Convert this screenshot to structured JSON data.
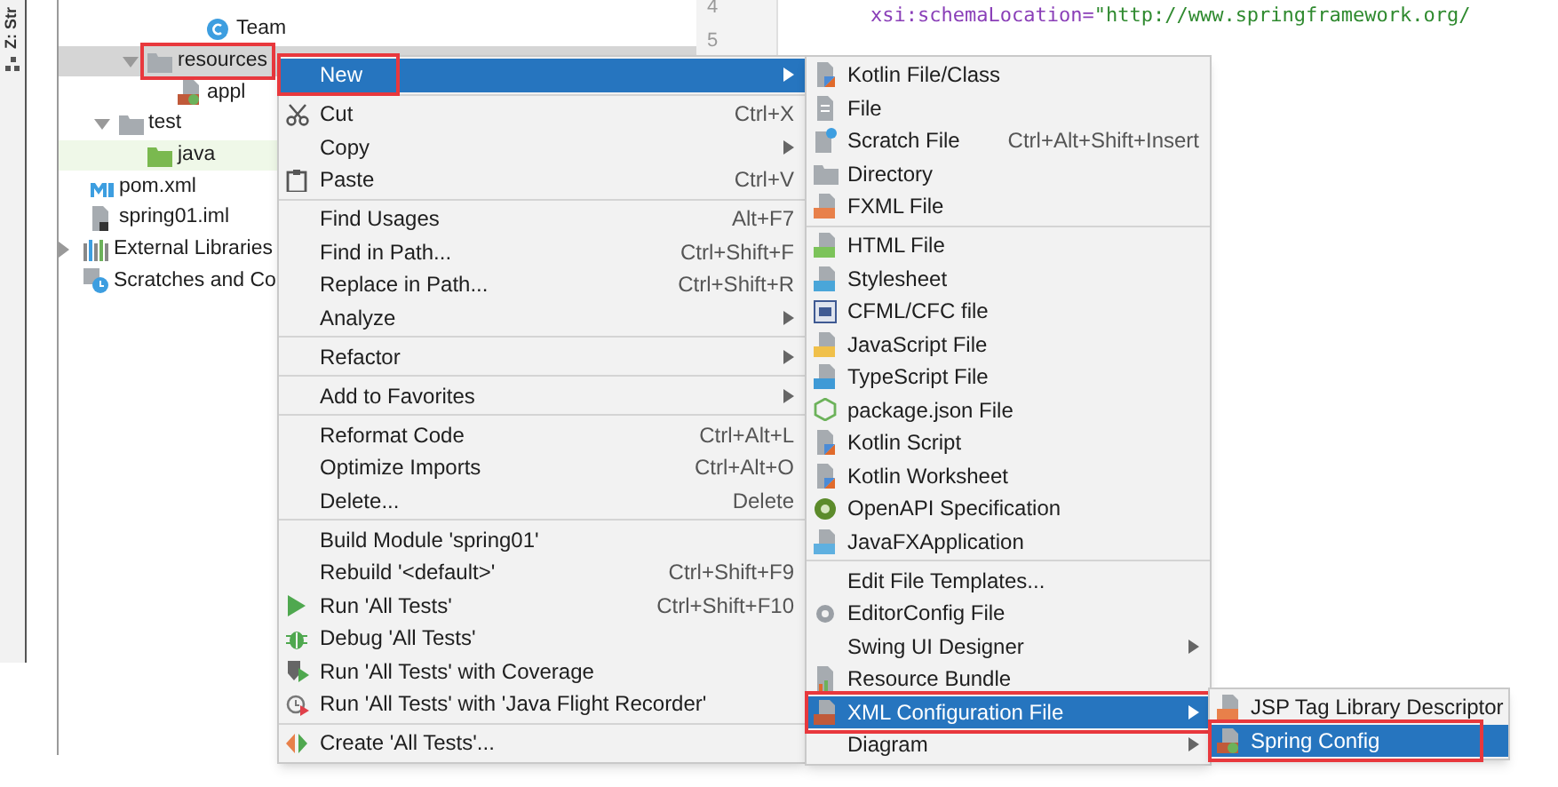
{
  "side_strip": {
    "label": "Z: Str"
  },
  "project_tree": [
    {
      "children": [
        {
          "children": [
            {
              "children": [
                {
                  "children": [
                    {
                      "children": [
                        {
                          "label": "Team",
                          "kind": "class"
                        }
                      ]
                    }
                  ]
                },
                {
                  "label": "resources",
                  "kind": "folder",
                  "expanded": true,
                  "selected": true,
                  "annotated": true,
                  "children": [
                    {
                      "label": "appl",
                      "kind": "xml"
                    }
                  ]
                }
              ]
            },
            {
              "label": "test",
              "kind": "folder",
              "expanded": true,
              "children": [
                {
                  "label": "java",
                  "kind": "test-root"
                }
              ]
            }
          ]
        },
        {
          "label": "pom.xml",
          "kind": "maven"
        },
        {
          "label": "spring01.iml",
          "kind": "module-file"
        }
      ]
    },
    {
      "label": "External Libraries",
      "kind": "libraries",
      "expanded": false
    },
    {
      "label": "Scratches and Co",
      "kind": "scratches"
    }
  ],
  "gutter": {
    "line_numbers": [
      "4",
      "5"
    ]
  },
  "editor": {
    "attribute": "xsi:schemaLocation=",
    "value": "\"http://www.springframework.org/"
  },
  "context_menu": {
    "groups": [
      [
        {
          "label": "New",
          "submenu": true,
          "selected": true,
          "annotated": true
        }
      ],
      [
        {
          "label": "Cut",
          "shortcut": "Ctrl+X",
          "selected": false
        },
        {
          "label": "Copy",
          "submenu": true,
          "selected": false
        },
        {
          "label": "Paste",
          "shortcut": "Ctrl+V",
          "selected": false
        }
      ],
      [
        {
          "label": "Find Usages",
          "shortcut": "Alt+F7",
          "selected": false
        },
        {
          "label": "Find in Path...",
          "shortcut": "Ctrl+Shift+F",
          "selected": false
        },
        {
          "label": "Replace in Path...",
          "shortcut": "Ctrl+Shift+R",
          "selected": false
        },
        {
          "label": "Analyze",
          "submenu": true,
          "selected": false
        }
      ],
      [
        {
          "label": "Refactor",
          "submenu": true,
          "selected": false
        }
      ],
      [
        {
          "label": "Add to Favorites",
          "submenu": true,
          "selected": false
        }
      ],
      [
        {
          "label": "Reformat Code",
          "shortcut": "Ctrl+Alt+L",
          "selected": false
        },
        {
          "label": "Optimize Imports",
          "shortcut": "Ctrl+Alt+O",
          "selected": false
        },
        {
          "label": "Delete...",
          "shortcut": "Delete",
          "selected": false
        }
      ],
      [
        {
          "label": "Build Module 'spring01'",
          "selected": false
        },
        {
          "label": "Rebuild '<default>'",
          "shortcut": "Ctrl+Shift+F9",
          "selected": false
        },
        {
          "label": "Run 'All Tests'",
          "shortcut": "Ctrl+Shift+F10",
          "selected": false
        },
        {
          "label": "Debug 'All Tests'",
          "selected": false
        },
        {
          "label": "Run 'All Tests' with Coverage",
          "selected": false
        },
        {
          "label": "Run 'All Tests' with 'Java Flight Recorder'",
          "selected": false
        }
      ],
      [
        {
          "label": "Create 'All Tests'...",
          "selected": false
        }
      ]
    ]
  },
  "new_submenu": {
    "groups": [
      [
        {
          "label": "Kotlin File/Class",
          "selected": false
        },
        {
          "label": "File",
          "selected": false
        },
        {
          "label": "Scratch File",
          "shortcut": "Ctrl+Alt+Shift+Insert",
          "selected": false
        },
        {
          "label": "Directory",
          "selected": false
        },
        {
          "label": "FXML File",
          "selected": false
        }
      ],
      [
        {
          "label": "HTML File",
          "selected": false
        },
        {
          "label": "Stylesheet",
          "selected": false
        },
        {
          "label": "CFML/CFC file",
          "selected": false
        },
        {
          "label": "JavaScript File",
          "selected": false
        },
        {
          "label": "TypeScript File",
          "selected": false
        },
        {
          "label": "package.json File",
          "selected": false
        },
        {
          "label": "Kotlin Script",
          "selected": false
        },
        {
          "label": "Kotlin Worksheet",
          "selected": false
        },
        {
          "label": "OpenAPI Specification",
          "selected": false
        },
        {
          "label": "JavaFXApplication",
          "selected": false
        }
      ],
      [
        {
          "label": "Edit File Templates...",
          "selected": false
        },
        {
          "label": "EditorConfig File",
          "selected": false
        },
        {
          "label": "Swing UI Designer",
          "submenu": true,
          "selected": false
        },
        {
          "label": "Resource Bundle",
          "selected": false
        },
        {
          "label": "XML Configuration File",
          "submenu": true,
          "selected": true,
          "annotated": true
        },
        {
          "label": "Diagram",
          "submenu": true,
          "selected": false
        }
      ]
    ]
  },
  "xml_submenu": {
    "groups": [
      [
        {
          "label": "JSP Tag Library Descriptor",
          "selected": false
        },
        {
          "label": "Spring Config",
          "selected": true,
          "annotated": true
        }
      ]
    ]
  }
}
